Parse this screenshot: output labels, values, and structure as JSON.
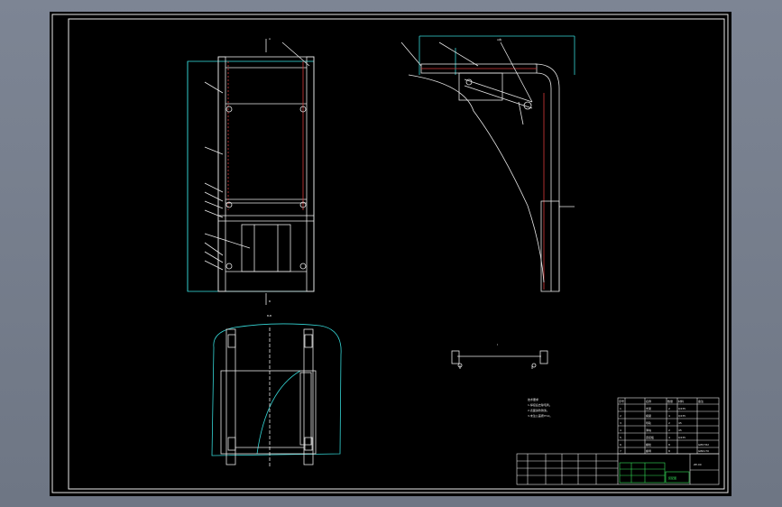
{
  "colors": {
    "background": "#7d8594",
    "sheet": "#000000",
    "line": "#e8e8e8",
    "dimension": "#35d6d6",
    "detail": "#d63a3a",
    "title_block_accent": "#35e35a"
  },
  "drawing": {
    "views": [
      "front-view",
      "side-view",
      "plan-view",
      "detail-view"
    ],
    "notes": [
      "技术要求",
      "1.焊接后去除毛刺。",
      "2.表面涂防锈漆。",
      "3.未注公差按IT12。"
    ],
    "title_block": {
      "header": [
        "序号",
        "代号",
        "名称",
        "数量",
        "材料",
        "备注"
      ],
      "rows": [
        [
          "1",
          "",
          "支架",
          "2",
          "Q235",
          ""
        ],
        [
          "2",
          "",
          "横梁",
          "4",
          "Q235",
          ""
        ],
        [
          "3",
          "",
          "导轨",
          "2",
          "45",
          ""
        ],
        [
          "4",
          "",
          "滑块",
          "2",
          "45",
          ""
        ],
        [
          "5",
          "",
          "连接板",
          "4",
          "Q235",
          ""
        ],
        [
          "6",
          "",
          "螺栓",
          "8",
          "",
          "GB5782"
        ],
        [
          "7",
          "",
          "螺母",
          "8",
          "",
          "GB6170"
        ]
      ],
      "name": "装配图",
      "sheet_id": "ZP-00"
    },
    "labels": {
      "a": "A",
      "b": "B",
      "side": "A向",
      "plan": "B-B",
      "detail": "I"
    }
  }
}
